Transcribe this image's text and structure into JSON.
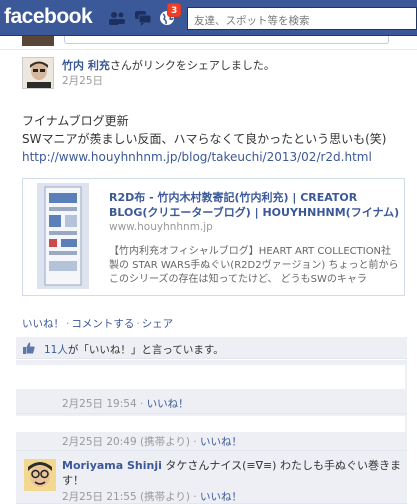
{
  "header": {
    "logo": "facebook",
    "notification_count": "3",
    "search_placeholder": "友達、スポット等を検索"
  },
  "post": {
    "author": "竹内 利充",
    "action_text": "さんがリンクをシェアしました。",
    "time": "2月25日",
    "text_line1": "フイナムブログ更新",
    "text_line2": "SWマニアが羨ましい反面、ハマらなくて良かったという思いも(笑)",
    "link": "http://www.houyhnhnm.jp/blog/takeuchi/2013/02/r2d.html",
    "attachment": {
      "title": "R2D布 - 竹内木村敦寄記(竹内利充) | CREATOR BLOG(クリエーターブログ) | HOUYHNHNM(フイナム)",
      "url": "www.houyhnhnm.jp",
      "description": "【竹内利充オフィシャルブログ】HEART ART COLLECTION社製の STAR WARS手ぬぐい(R2D2ヴァージョン) ちょっと前からこのシリーズの存在は知ってたけど、 どうもSWのキャラ"
    },
    "actions": {
      "like": "いいね！",
      "comment": "コメントする",
      "share": "シェア",
      "separator": "·"
    },
    "likes_count": "11人",
    "likes_suffix": "が「いいね！」と言っています。"
  },
  "comments": [
    {
      "time": "2月25日 19:54",
      "like": "いいね！"
    },
    {
      "time": "2月25日 20:49 (携帯より)",
      "like": "いいね！"
    },
    {
      "author": "Moriyama Shinji",
      "text": "タケさんナイス(≡∇≡) わたしも手ぬぐい巻きます！",
      "time": "2月25日 21:55 (携帯より)",
      "like": "いいね！"
    }
  ],
  "colors": {
    "brand": "#3b5998",
    "ufi_bg": "#edeff4",
    "badge": "#f03d25"
  }
}
